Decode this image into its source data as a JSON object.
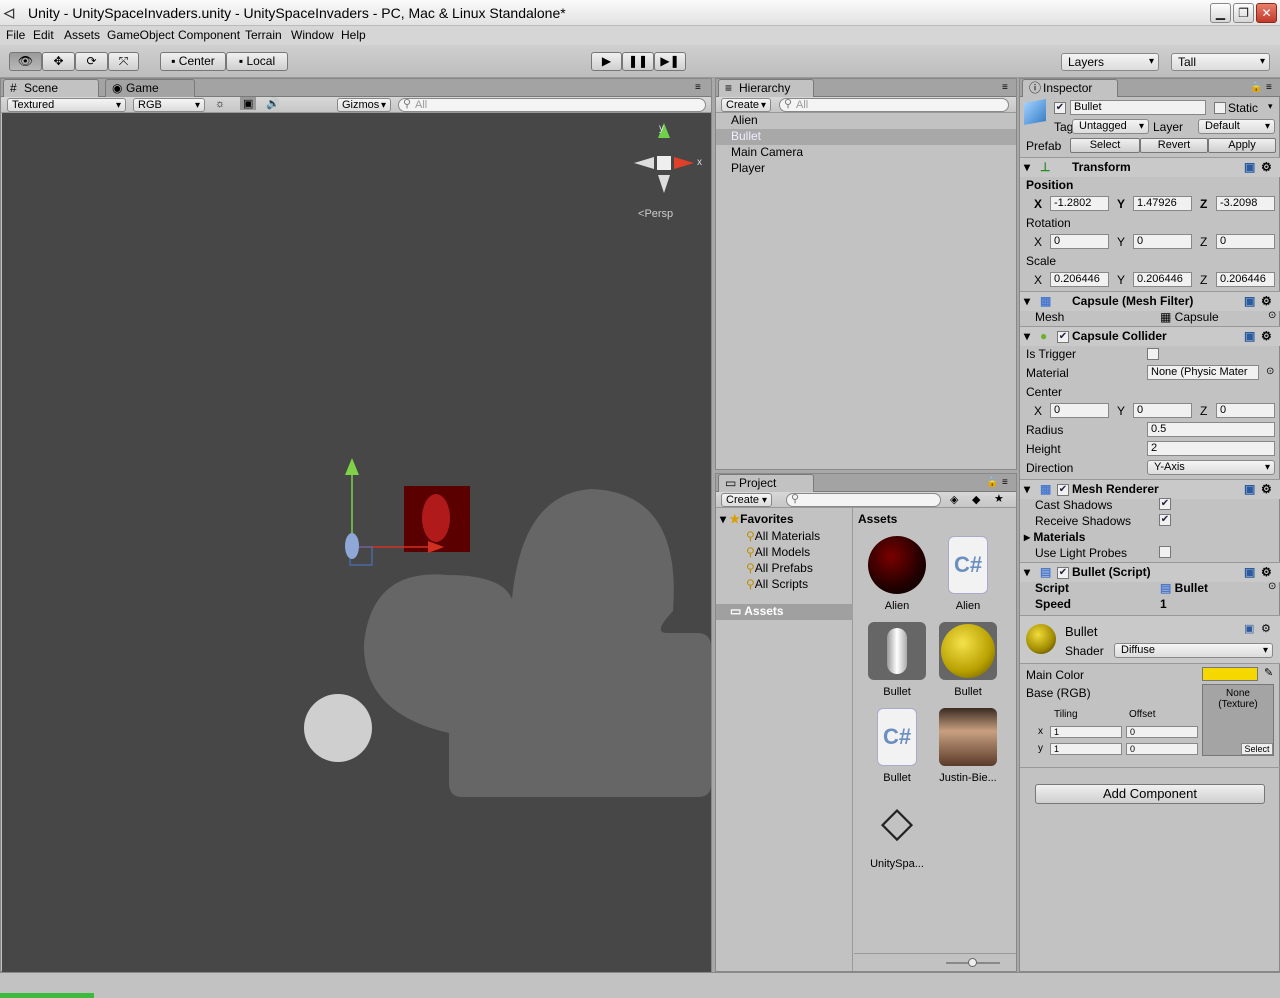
{
  "window": {
    "title": "Unity - UnitySpaceInvaders.unity - UnitySpaceInvaders - PC, Mac & Linux Standalone*",
    "btn_min": "▁",
    "btn_max": "❐",
    "btn_close": "✕"
  },
  "menu": [
    "File",
    "Edit",
    "Assets",
    "GameObject",
    "Component",
    "Terrain",
    "Window",
    "Help"
  ],
  "toolbar": {
    "center": "Center",
    "local": "Local",
    "layers": "Layers",
    "layout": "Tall"
  },
  "scene": {
    "tab": "Scene",
    "game_tab": "Game",
    "render_mode": "Textured",
    "color_mode": "RGB",
    "gizmos": "Gizmos",
    "search_placeholder": "All",
    "persp": "Persp",
    "gizmo_y": "y",
    "gizmo_x": "x"
  },
  "hierarchy": {
    "tab": "Hierarchy",
    "create": "Create",
    "search_placeholder": "All",
    "items": [
      "Alien",
      "Bullet",
      "Main Camera",
      "Player"
    ],
    "selected_index": 1
  },
  "project": {
    "tab": "Project",
    "create": "Create",
    "favorites": "Favorites",
    "fav_items": [
      "All Materials",
      "All Models",
      "All Prefabs",
      "All Scripts"
    ],
    "assets_folder": "Assets",
    "assets_header": "Assets",
    "assets": [
      {
        "name": "Alien",
        "kind": "material-red"
      },
      {
        "name": "Alien",
        "kind": "script"
      },
      {
        "name": "Bullet",
        "kind": "capsule"
      },
      {
        "name": "Bullet",
        "kind": "material-yellow"
      },
      {
        "name": "Bullet",
        "kind": "script"
      },
      {
        "name": "Justin-Bie...",
        "kind": "texture"
      },
      {
        "name": "UnitySpa...",
        "kind": "unity-scene"
      }
    ]
  },
  "inspector": {
    "tab": "Inspector",
    "name": "Bullet",
    "static": "Static",
    "tag_label": "Tag",
    "tag": "Untagged",
    "layer_label": "Layer",
    "layer": "Default",
    "prefab_label": "Prefab",
    "select": "Select",
    "revert": "Revert",
    "apply": "Apply",
    "transform": {
      "title": "Transform",
      "position": "Position",
      "rotation": "Rotation",
      "scale": "Scale",
      "pos": [
        "-1.2802",
        "1.47926",
        "-3.2098"
      ],
      "rot": [
        "0",
        "0",
        "0"
      ],
      "scl": [
        "0.206446",
        "0.206446",
        "0.206446"
      ]
    },
    "axis": {
      "x": "X",
      "y": "Y",
      "z": "Z"
    },
    "mesh_filter": {
      "title": "Capsule (Mesh Filter)",
      "mesh_label": "Mesh",
      "mesh": "Capsule"
    },
    "collider": {
      "title": "Capsule Collider",
      "is_trigger": "Is Trigger",
      "material_label": "Material",
      "material": "None (Physic Mater",
      "center": "Center",
      "c": [
        "0",
        "0",
        "0"
      ],
      "radius_label": "Radius",
      "radius": "0.5",
      "height_label": "Height",
      "height": "2",
      "direction_label": "Direction",
      "direction": "Y-Axis"
    },
    "renderer": {
      "title": "Mesh Renderer",
      "cast": "Cast Shadows",
      "receive": "Receive Shadows",
      "materials": "Materials",
      "light_probes": "Use Light Probes"
    },
    "script": {
      "title": "Bullet (Script)",
      "script_label": "Script",
      "script": "Bullet",
      "speed_label": "Speed",
      "speed": "1"
    },
    "material": {
      "name": "Bullet",
      "shader_label": "Shader",
      "shader": "Diffuse",
      "main_color": "Main Color",
      "base": "Base (RGB)",
      "tiling": "Tiling",
      "offset": "Offset",
      "tx": "1",
      "ty": "1",
      "ox": "0",
      "oy": "0",
      "none_tex": "None\n(Texture)",
      "select": "Select",
      "ax": "x",
      "ay": "y",
      "color": "#f5d800"
    },
    "add_component": "Add Component"
  }
}
